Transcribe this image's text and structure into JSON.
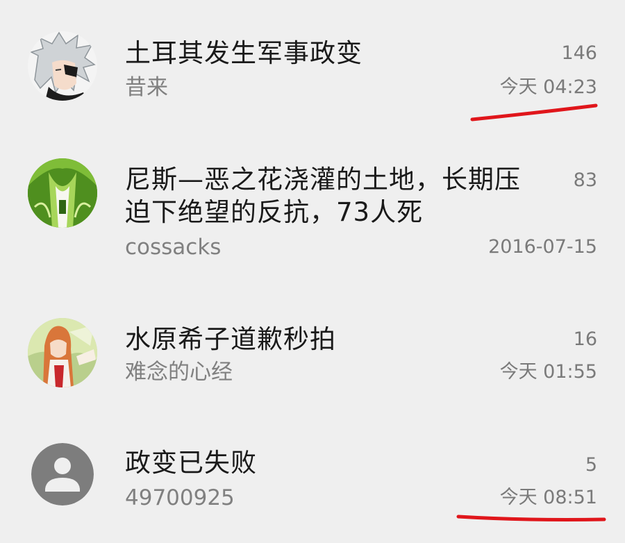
{
  "threads": [
    {
      "title": "土耳其发生军事政变",
      "author": "昔来",
      "count": "146",
      "time": "今天 04:23",
      "avatar": "anime-silver-hair-avatar"
    },
    {
      "title_line1": "尼斯—恶之花浇灌的土地，长期压",
      "title_line2": "迫下绝望的反抗，73人死",
      "author": "cossacks",
      "count": "83",
      "time": "2016-07-15",
      "avatar": "green-abstract-avatar"
    },
    {
      "title": "水原希子道歉秒拍",
      "author": "难念的心经",
      "count": "16",
      "time": "今天 01:55",
      "avatar": "anime-orange-hair-avatar"
    },
    {
      "title": "政变已失败",
      "author": "49700925",
      "count": "5",
      "time": "今天 08:51",
      "avatar": "default-user-avatar"
    }
  ],
  "colors": {
    "background": "#efefef",
    "title": "#1a1a1a",
    "secondary": "#7a7a7a",
    "annotation": "#e0161b"
  }
}
